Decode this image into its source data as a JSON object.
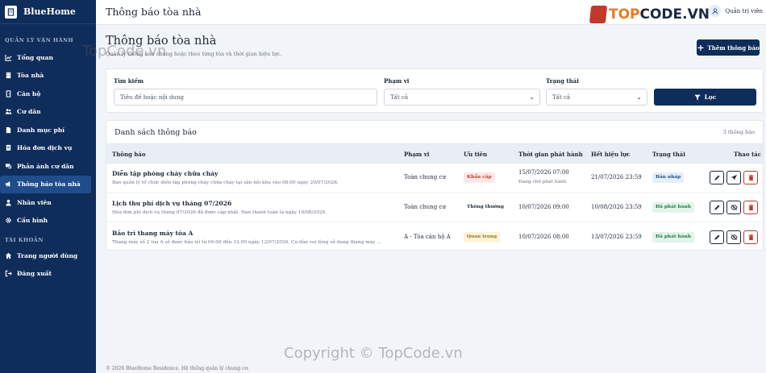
{
  "app": {
    "brand": "BlueHome"
  },
  "sidebar": {
    "section_manage": "QUẢN LÝ VẬN HÀNH",
    "items": [
      {
        "label": "Tổng quan",
        "icon": "chart-line-icon"
      },
      {
        "label": "Tòa nhà",
        "icon": "building-icon"
      },
      {
        "label": "Căn hộ",
        "icon": "door-icon"
      },
      {
        "label": "Cư dân",
        "icon": "users-icon"
      },
      {
        "label": "Danh mục phí",
        "icon": "file-icon"
      },
      {
        "label": "Hóa đơn dịch vụ",
        "icon": "receipt-icon"
      },
      {
        "label": "Phản ánh cư dân",
        "icon": "comments-icon"
      },
      {
        "label": "Thông báo tòa nhà",
        "icon": "megaphone-icon",
        "active": true
      },
      {
        "label": "Nhân viên",
        "icon": "user-tie-icon"
      },
      {
        "label": "Cấu hình",
        "icon": "gear-icon"
      }
    ],
    "section_account": "TÀI KHOẢN",
    "account_items": [
      {
        "label": "Trang người dùng",
        "icon": "home-icon"
      },
      {
        "label": "Đăng xuất",
        "icon": "logout-icon"
      }
    ]
  },
  "topbar": {
    "title": "Thông báo tòa nhà",
    "user_label": "Quản trị viên",
    "logo_text_a": "TOP",
    "logo_text_b": "CODE.VN"
  },
  "page": {
    "heading": "Thông báo tòa nhà",
    "subtitle": "Quản lý thông báo chung hoặc theo từng tòa và thời gian hiệu lực.",
    "add_button": "Thêm thông báo"
  },
  "filters": {
    "search_label": "Tìm kiếm",
    "search_placeholder": "Tiêu đề hoặc nội dung",
    "scope_label": "Phạm vi",
    "scope_value": "Tất cả",
    "status_label": "Trạng thái",
    "status_value": "Tất cả",
    "filter_button": "Lọc"
  },
  "table": {
    "title": "Danh sách thông báo",
    "count": "3 thông báo",
    "columns": [
      "Thông báo",
      "Phạm vi",
      "Ưu tiên",
      "Thời gian phát hành",
      "Hết hiệu lực",
      "Trạng thái",
      "Thao tác"
    ],
    "rows": [
      {
        "title": "Diễn tập phòng cháy chữa cháy",
        "desc": "Ban quản lý tổ chức diễn tập phòng cháy chữa cháy tại sân nội khu vào 08:00 ngày 20/07/2026.",
        "scope": "Toàn chung cư",
        "priority": "Khẩn cấp",
        "priority_style": "b-red",
        "publish": "15/07/2026 07:00",
        "publish_note": "Đang chờ phát hành",
        "expire": "21/07/2026 23:59",
        "status": "Bản nháp",
        "status_style": "b-blue",
        "second_action": "send-icon"
      },
      {
        "title": "Lịch thu phí dịch vụ tháng 07/2026",
        "desc": "Hóa đơn phí dịch vụ tháng 07/2026 đã được cập nhật. Hạn thanh toán là ngày 10/08/2026.",
        "scope": "Toàn chung cư",
        "priority": "Thông thường",
        "priority_style": "b-gray",
        "publish": "10/07/2026 09:00",
        "publish_note": "",
        "expire": "10/08/2026 23:59",
        "status": "Đã phát hành",
        "status_style": "b-green",
        "second_action": "eye-slash-icon"
      },
      {
        "title": "Bảo trì thang máy tòa A",
        "desc": "Thang máy số 2 tòa A sẽ được bảo trì từ 09:00 đến 12:00 ngày 12/07/2026. Cư dân vui lòng sử dụng thang máy ...",
        "scope": "A - Tòa căn hộ A",
        "priority": "Quan trọng",
        "priority_style": "b-yellow",
        "publish": "10/07/2026 08:00",
        "publish_note": "",
        "expire": "13/07/2026 23:59",
        "status": "Đã phát hành",
        "status_style": "b-green",
        "second_action": "eye-slash-icon"
      }
    ]
  },
  "footer": "© 2026 BlueHome Residence. Hệ thống quản lý chung cư.",
  "watermarks": [
    "TopCode.vn",
    "Copyright © TopCode.vn"
  ]
}
